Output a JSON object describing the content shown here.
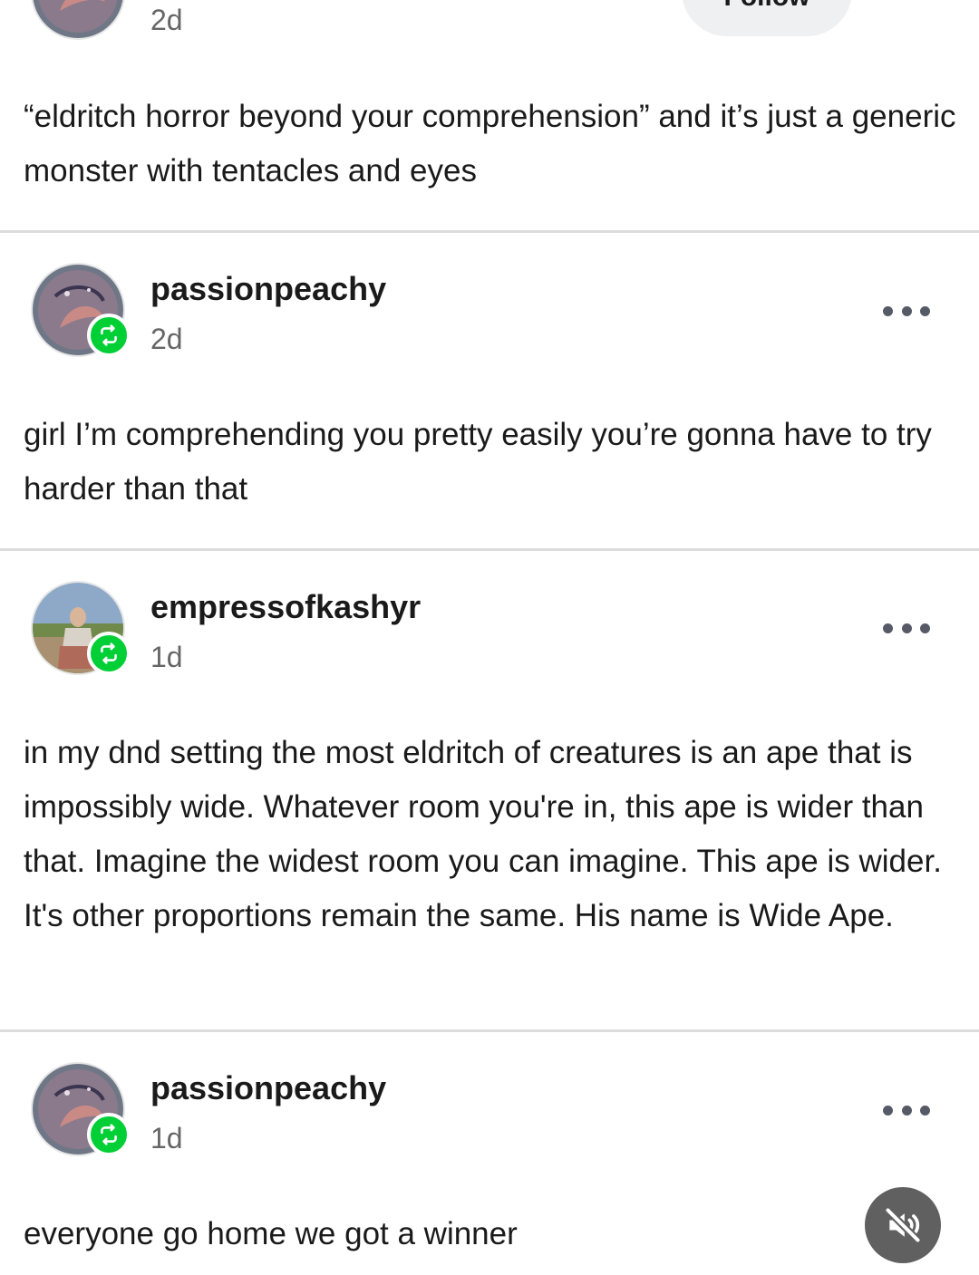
{
  "top_post": {
    "timestamp": "2d",
    "follow_label": "Follow",
    "body": "“eldritch horror beyond your comprehension” and it’s just a generic monster with tentacles and eyes"
  },
  "posts": [
    {
      "username": "passionpeachy",
      "timestamp": "2d",
      "body": "girl I’m comprehending you pretty easily you’re gonna have to try harder than that",
      "avatar_icon": "moon-avatar"
    },
    {
      "username": "empressofkashyr",
      "timestamp": "1d",
      "body": "in my dnd setting the most eldritch of creatures is an ape that is impossibly wide. Whatever room you're in, this ape is wider than that. Imagine the widest room you can imagine. This ape is wider. It's other proportions remain the same. His name is Wide Ape.",
      "avatar_icon": "photo-avatar"
    },
    {
      "username": "passionpeachy",
      "timestamp": "1d",
      "body": "everyone go home we got a winner",
      "avatar_icon": "moon-avatar"
    }
  ],
  "icons": {
    "reblog": "reblog-icon",
    "more": "more-options-icon",
    "mute": "muted-speaker-icon"
  },
  "colors": {
    "reblog_badge": "#00cf35",
    "divider": "#dcdcdc",
    "timestamp": "#666666",
    "mute_button": "#606060"
  }
}
